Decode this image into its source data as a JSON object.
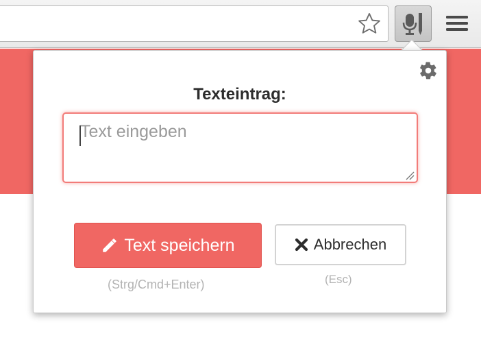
{
  "browser": {
    "bookmark_icon": "star-icon",
    "extension_icon": "microphone-pen-icon",
    "menu_icon": "hamburger-menu-icon"
  },
  "popup": {
    "settings_icon": "gear-icon",
    "title": "Texteintrag:",
    "textarea": {
      "placeholder": "Text eingeben",
      "value": ""
    },
    "save_button": {
      "icon": "pencil-icon",
      "label": "Text speichern",
      "hint": "(Strg/Cmd+Enter)"
    },
    "cancel_button": {
      "icon": "close-icon",
      "label": "Abbrechen",
      "hint": "(Esc)"
    }
  },
  "colors": {
    "accent": "#f06763",
    "hint_text": "#b3b3b3",
    "title_text": "#2d2d2d"
  }
}
